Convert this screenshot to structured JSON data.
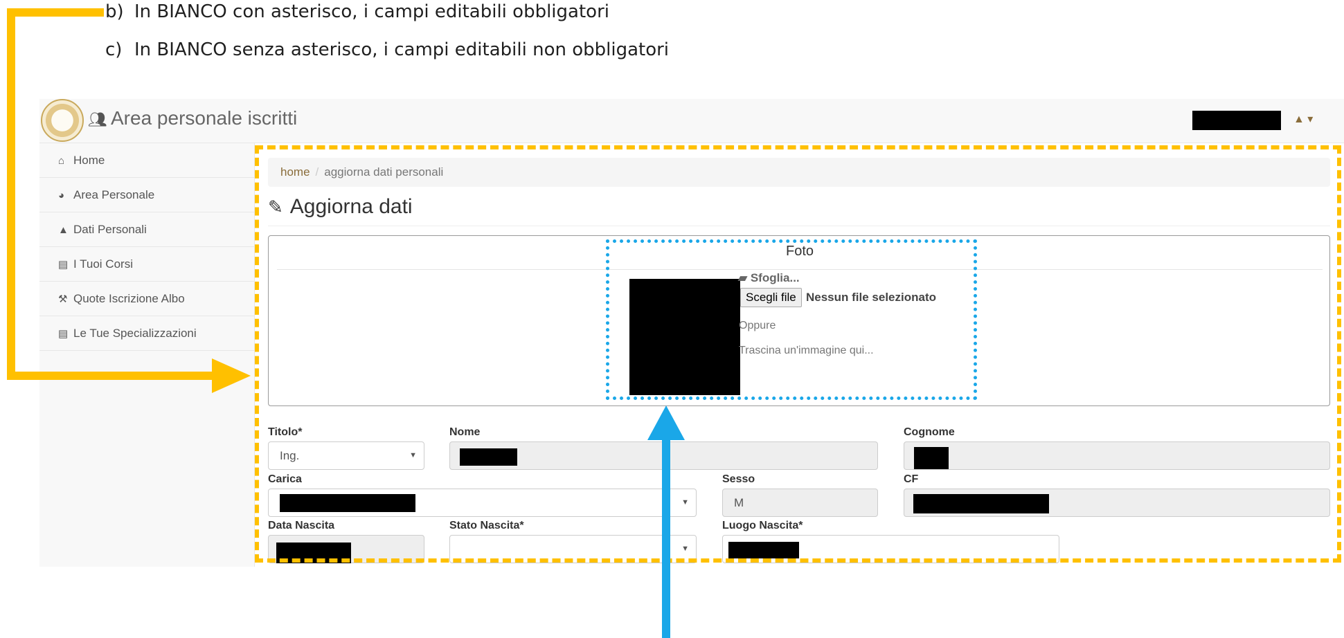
{
  "notes": {
    "b": {
      "label": "b)",
      "text": "In BIANCO con asterisco, i campi editabili obbligatori"
    },
    "c": {
      "label": "c)",
      "text": "In BIANCO senza asterisco, i campi editabili non obbligatori"
    }
  },
  "colors": {
    "annotation_yellow": "#ffc000",
    "annotation_blue": "#1aa7e8",
    "link_brown": "#8a6d3b"
  },
  "header": {
    "title": "Area personale iscritti",
    "users_icon": "users-icon",
    "user_menu_icon": "user-icon"
  },
  "sidebar": {
    "items": [
      {
        "label": "Home",
        "icon": "home-icon"
      },
      {
        "label": "Area Personale",
        "icon": "dashboard-icon"
      },
      {
        "label": "Dati Personali",
        "icon": "user-icon"
      },
      {
        "label": "I Tuoi Corsi",
        "icon": "calendar-icon"
      },
      {
        "label": "Quote Iscrizione Albo",
        "icon": "gavel-icon"
      },
      {
        "label": "Le Tue Specializzazioni",
        "icon": "calendar-icon"
      }
    ]
  },
  "breadcrumb": {
    "home": "home",
    "sep": "/",
    "current": "aggiorna dati personali"
  },
  "page_title": "Aggiorna dati",
  "foto": {
    "heading": "Foto",
    "browse": "Sfoglia...",
    "choose_button": "Scegli file",
    "no_file": "Nessun file selezionato",
    "or": "Oppure",
    "drop_hint": "Trascina un'immagine qui..."
  },
  "form": {
    "titolo": {
      "label": "Titolo*",
      "value": "Ing."
    },
    "nome": {
      "label": "Nome"
    },
    "cognome": {
      "label": "Cognome"
    },
    "carica": {
      "label": "Carica"
    },
    "sesso": {
      "label": "Sesso",
      "value": "M"
    },
    "cf": {
      "label": "CF"
    },
    "data_nascita": {
      "label": "Data Nascita"
    },
    "stato_nascita": {
      "label": "Stato Nascita*",
      "value": ""
    },
    "luogo_nascita": {
      "label": "Luogo Nascita*"
    }
  }
}
